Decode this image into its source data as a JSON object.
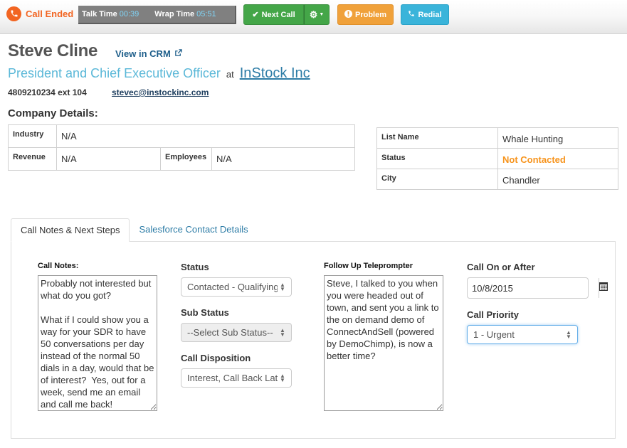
{
  "topbar": {
    "call_status": "Call Ended",
    "talk_time_label": "Talk Time",
    "talk_time_value": "00:39",
    "wrap_time_label": "Wrap Time",
    "wrap_time_value": "05:51",
    "buttons": {
      "next_call": "Next Call",
      "problem": "Problem",
      "redial": "Redial"
    },
    "icons": {
      "call_status": "phone-icon",
      "next_call": "check-icon",
      "settings": "gear-icon",
      "dropdown": "caret-down-icon",
      "problem": "exclamation-circle-icon",
      "redial": "phone-icon"
    }
  },
  "contact": {
    "name": "Steve Cline",
    "crm_link": "View in CRM",
    "title": "President and Chief Executive Officer",
    "at": "at",
    "company": "InStock Inc",
    "phone": "4809210234 ext 104",
    "email": "stevec@instockinc.com"
  },
  "company_details": {
    "heading": "Company Details:",
    "industry_label": "Industry",
    "industry_value": "N/A",
    "revenue_label": "Revenue",
    "revenue_value": "N/A",
    "employees_label": "Employees",
    "employees_value": "N/A"
  },
  "list_info": {
    "list_name_label": "List Name",
    "list_name_value": "Whale Hunting",
    "status_label": "Status",
    "status_value": "Not Contacted",
    "status_color": "#f7941d",
    "city_label": "City",
    "city_value": "Chandler"
  },
  "tabs": [
    {
      "label": "Call Notes & Next Steps",
      "active": true
    },
    {
      "label": "Salesforce Contact Details",
      "active": false
    }
  ],
  "call_notes": {
    "label": "Call Notes:",
    "value": "Probably not interested but what do you got?\n\nWhat if I could show you a way for your SDR to have 50 conversations per day instead of the normal 50 dials in a day, would that be of interest?  Yes, out for a week, send me an email and call me back!"
  },
  "status": {
    "label": "Status",
    "selected": "Contacted - Qualifying"
  },
  "sub_status": {
    "label": "Sub Status",
    "selected": "--Select Sub Status--"
  },
  "call_disposition": {
    "label": "Call Disposition",
    "selected": "Interest, Call Back Later"
  },
  "teleprompter": {
    "label": "Follow Up Teleprompter",
    "value": "Steve, I talked to you when you were headed out of town, and sent you a link to the on demand demo of ConnectAndSell (powered by DemoChimp), is now a better time?"
  },
  "call_on_after": {
    "label": "Call On or After",
    "value": "10/8/2015"
  },
  "call_priority": {
    "label": "Call Priority",
    "selected": "1 - Urgent"
  },
  "colors": {
    "call_ended": "#f26522",
    "next_call": "#44a648",
    "problem": "#f0a13a",
    "redial": "#3ab4da",
    "title": "#5bb8d8",
    "link": "#2d7ca6"
  }
}
